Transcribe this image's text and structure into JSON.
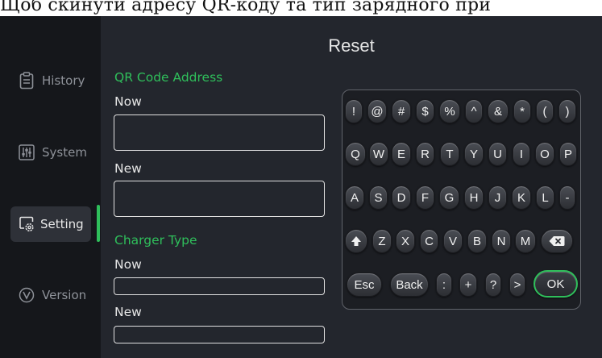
{
  "caption": "Щоб скинути адресу QR-коду та тип зарядного при",
  "sidebar": {
    "items": [
      {
        "label": "History",
        "icon": "clipboard-icon"
      },
      {
        "label": "System",
        "icon": "sliders-icon"
      },
      {
        "label": "Setting",
        "icon": "settings-gear-icon",
        "active": true
      },
      {
        "label": "Version",
        "icon": "version-v-icon"
      }
    ]
  },
  "page": {
    "title": "Reset",
    "qr": {
      "heading": "QR Code Address",
      "now_label": "Now",
      "now_value": "",
      "new_label": "New",
      "new_value": ""
    },
    "charger": {
      "heading": "Charger Type",
      "now_label": "Now",
      "now_value": "",
      "new_label": "New",
      "new_value": ""
    }
  },
  "keyboard": {
    "rows": [
      [
        "!",
        "@",
        "#",
        "$",
        "%",
        "^",
        "&",
        "*",
        "(",
        ")"
      ],
      [
        "Q",
        "W",
        "E",
        "R",
        "T",
        "Y",
        "U",
        "I",
        "O",
        "P"
      ],
      [
        "A",
        "S",
        "D",
        "F",
        "G",
        "H",
        "J",
        "K",
        "L",
        "-"
      ],
      [
        "shift",
        "Z",
        "X",
        "C",
        "V",
        "B",
        "N",
        "M",
        "backspace"
      ],
      [
        "Esc",
        "Back",
        ":",
        "+",
        "?",
        ">",
        "OK"
      ]
    ],
    "shift_icon": "shift-up-arrow-icon",
    "backspace_icon": "backspace-icon"
  },
  "colors": {
    "accent": "#2fbf5b",
    "background": "#23262d",
    "sidebar": "#15171b"
  }
}
